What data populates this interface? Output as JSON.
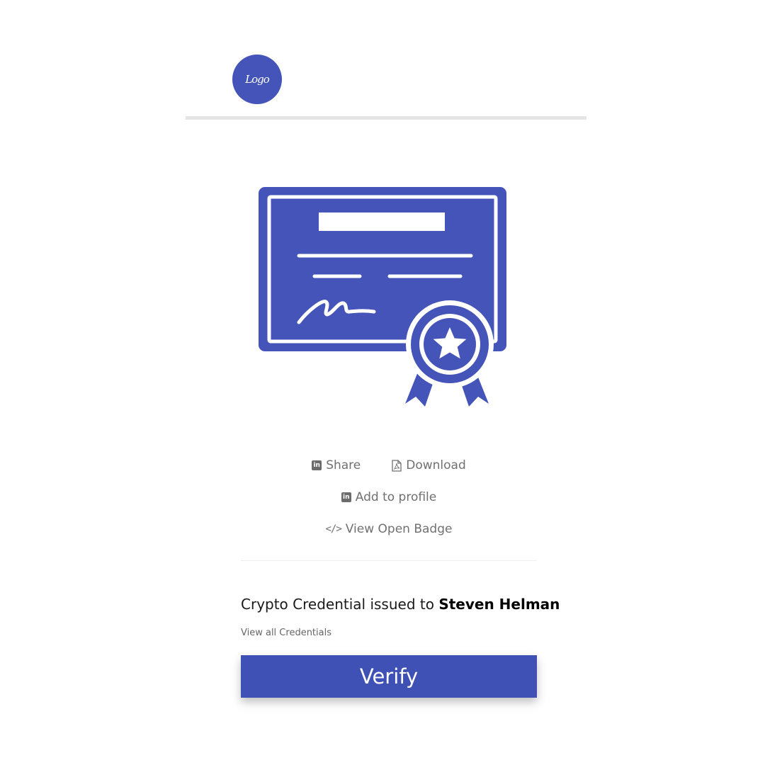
{
  "header": {
    "logo_text": "Logo"
  },
  "actions": {
    "share_label": "Share",
    "download_label": "Download",
    "add_to_profile_label": "Add to profile",
    "view_open_badge_label": "View Open Badge"
  },
  "credential": {
    "issued_prefix": "Crypto Credential issued to ",
    "recipient_name": "Steven Helman",
    "view_all_label": "View all Credentials"
  },
  "verify": {
    "label": "Verify"
  },
  "icons": {
    "share": "linkedin-icon",
    "download": "pdf-file-icon",
    "add_to_profile": "linkedin-icon",
    "view_open_badge": "code-icon",
    "certificate": "certificate-icon"
  },
  "colors": {
    "brand": "#4454b8",
    "button": "#3f51b5",
    "muted_text": "#707070"
  }
}
